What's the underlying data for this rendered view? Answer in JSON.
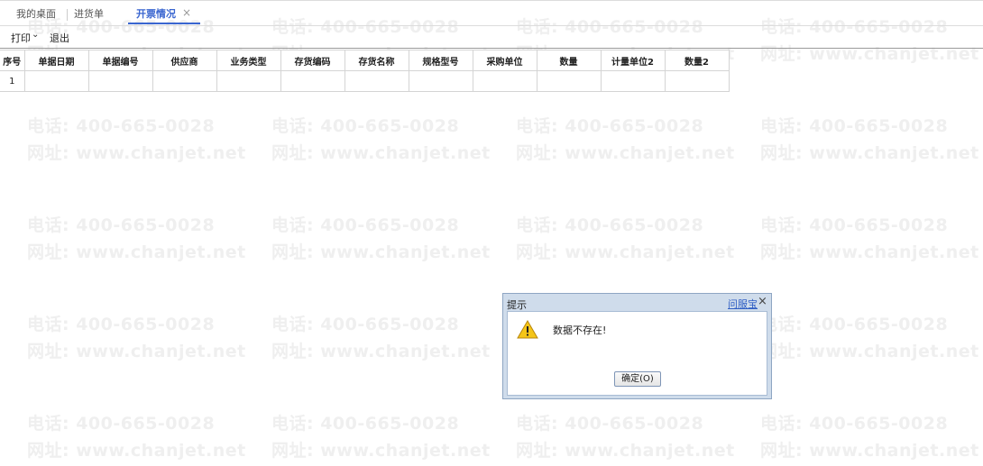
{
  "watermark": {
    "phone": "电话: 400-665-0028",
    "site": "网址: www.chanjet.net"
  },
  "tabs": [
    {
      "label": "我的桌面"
    },
    {
      "label": "进货单"
    },
    {
      "label": "开票情况",
      "active": true
    }
  ],
  "tab_close_glyph": "×",
  "toolbar": {
    "print_label": "打印",
    "print_arrow": "⌄",
    "exit_label": "退出"
  },
  "grid": {
    "columns": [
      "序号",
      "单据日期",
      "单据编号",
      "供应商",
      "业务类型",
      "存货编码",
      "存货名称",
      "规格型号",
      "采购单位",
      "数量",
      "计量单位2",
      "数量2"
    ],
    "rows": [
      [
        "1",
        "",
        "",
        "",
        "",
        "",
        "",
        "",
        "",
        "",
        "",
        ""
      ]
    ]
  },
  "dialog": {
    "title": "提示",
    "help_link": "问服宝",
    "close_glyph": "×",
    "icon": "warning-icon",
    "message": "数据不存在!",
    "ok_label": "确定(O)"
  },
  "colors": {
    "accent": "#3a66d0",
    "dialog_frame": "#cfdceb",
    "watermark": "#efefef"
  }
}
